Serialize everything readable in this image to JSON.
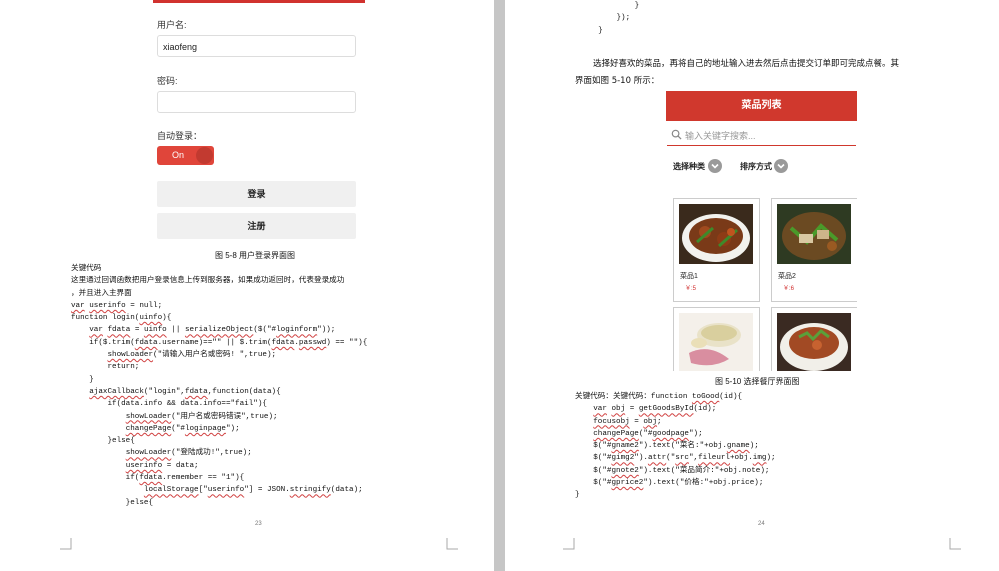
{
  "left_page": {
    "login": {
      "username_label": "用户名:",
      "username_value": "xiaofeng",
      "password_label": "密码:",
      "autologin_label": "自动登录：",
      "toggle_text": "On",
      "login_button": "登录",
      "register_button": "注册"
    },
    "caption": "图 5-8 用户登录界面图",
    "code_lines": [
      [
        {
          "t": "关键代码"
        }
      ],
      [
        {
          "t": "这里通过回调函数把用户登录信息上传到服务器，如果成功返回时，代表登录成功"
        }
      ],
      [
        {
          "t": "，并且进入主界面"
        }
      ],
      [
        {
          "t": "var",
          "s": 1
        },
        {
          "t": " "
        },
        {
          "t": "userinfo",
          "s": 1
        },
        {
          "t": " = null;"
        }
      ],
      [
        {
          "t": "function login("
        },
        {
          "t": "uinfo",
          "s": 1
        },
        {
          "t": "){"
        }
      ],
      [
        {
          "t": "    "
        },
        {
          "t": "var",
          "s": 1
        },
        {
          "t": " "
        },
        {
          "t": "fdata",
          "s": 1
        },
        {
          "t": " = "
        },
        {
          "t": "uinfo",
          "s": 1
        },
        {
          "t": " || "
        },
        {
          "t": "serializeObject",
          "s": 1
        },
        {
          "t": "($(\"#"
        },
        {
          "t": "loginform",
          "s": 1
        },
        {
          "t": "\"));"
        }
      ],
      [
        {
          "t": "    if($.trim("
        },
        {
          "t": "fdata",
          "s": 1
        },
        {
          "t": ".username)==\"\" || $.trim("
        },
        {
          "t": "fdata",
          "s": 1
        },
        {
          "t": "."
        },
        {
          "t": "passwd",
          "s": 1
        },
        {
          "t": ") == \"\"){"
        }
      ],
      [
        {
          "t": "        "
        },
        {
          "t": "showLoader",
          "s": 1
        },
        {
          "t": "(\"请输入用户名或密码! \",true);"
        }
      ],
      [
        {
          "t": "        return;"
        }
      ],
      [
        {
          "t": "    }"
        }
      ],
      [
        {
          "t": "    "
        },
        {
          "t": "ajaxCallback",
          "s": 1
        },
        {
          "t": "(\"login\","
        },
        {
          "t": "fdata",
          "s": 1
        },
        {
          "t": ",function(data){"
        }
      ],
      [
        {
          "t": "        if(data.info && data.info==\"fail\"){"
        }
      ],
      [
        {
          "t": "            "
        },
        {
          "t": "showLoader",
          "s": 1
        },
        {
          "t": "(\"用户名或密码错误\",true);"
        }
      ],
      [
        {
          "t": "            "
        },
        {
          "t": "changePage",
          "s": 1
        },
        {
          "t": "(\"#"
        },
        {
          "t": "loginpage",
          "s": 1
        },
        {
          "t": "\");"
        }
      ],
      [
        {
          "t": "        }else{"
        }
      ],
      [
        {
          "t": "            "
        },
        {
          "t": "showLoader",
          "s": 1
        },
        {
          "t": "(\"登陆成功!\",true);"
        }
      ],
      [
        {
          "t": "            "
        },
        {
          "t": "userinfo",
          "s": 1
        },
        {
          "t": " = data;"
        }
      ],
      [
        {
          "t": "            if("
        },
        {
          "t": "fdata",
          "s": 1
        },
        {
          "t": ".remember == \"1\"){"
        }
      ],
      [
        {
          "t": "                "
        },
        {
          "t": "localStorage",
          "s": 1
        },
        {
          "t": "[\""
        },
        {
          "t": "userinfo",
          "s": 1
        },
        {
          "t": "\"] = JSON."
        },
        {
          "t": "stringify",
          "s": 1
        },
        {
          "t": "(data);"
        }
      ],
      [
        {
          "t": "            }else{"
        }
      ]
    ],
    "page_number": "23"
  },
  "right_page": {
    "top_code_lines": [
      [
        {
          "t": "            }"
        }
      ],
      [
        {
          "t": "        });"
        }
      ],
      [
        {
          "t": "    }"
        }
      ]
    ],
    "paragraph_line1": "选择好喜欢的菜品，再将自己的地址输入进去然后点击提交订单即可完成点餐。其",
    "paragraph_line2": "界面如图 5-10 所示：",
    "menu": {
      "header": "菜品列表",
      "search_placeholder": "输入关键字搜索...",
      "filter_category": "选择种类",
      "filter_sort": "排序方式",
      "items": [
        {
          "name": "菜品1",
          "price": "￥:5"
        },
        {
          "name": "菜品2",
          "price": "￥:6"
        }
      ]
    },
    "caption": "图 5-10 选择餐厅界面图",
    "code_lines": [
      [
        {
          "t": "关键代码：关键代码：function "
        },
        {
          "t": "toGood",
          "s": 1
        },
        {
          "t": "(id){"
        }
      ],
      [
        {
          "t": "    "
        },
        {
          "t": "var",
          "s": 1
        },
        {
          "t": " "
        },
        {
          "t": "obj",
          "s": 1
        },
        {
          "t": " = "
        },
        {
          "t": "getGoodsById",
          "s": 1
        },
        {
          "t": "(id);"
        }
      ],
      [
        {
          "t": "    "
        },
        {
          "t": "focusobj",
          "s": 1
        },
        {
          "t": " = "
        },
        {
          "t": "obj",
          "s": 1
        },
        {
          "t": ";"
        }
      ],
      [
        {
          "t": "    "
        },
        {
          "t": "changePage",
          "s": 1
        },
        {
          "t": "(\"#"
        },
        {
          "t": "goodpage",
          "s": 1
        },
        {
          "t": "\");"
        }
      ],
      [
        {
          "t": "    $(\"#"
        },
        {
          "t": "gname2",
          "s": 1
        },
        {
          "t": "\").text(\"菜名:\"+obj."
        },
        {
          "t": "gname",
          "s": 1
        },
        {
          "t": ");"
        }
      ],
      [
        {
          "t": "    $(\"#"
        },
        {
          "t": "gimg2",
          "s": 1
        },
        {
          "t": "\")."
        },
        {
          "t": "attr",
          "s": 1
        },
        {
          "t": "(\""
        },
        {
          "t": "src",
          "s": 1
        },
        {
          "t": "\","
        },
        {
          "t": "fileurl",
          "s": 1
        },
        {
          "t": "+obj."
        },
        {
          "t": "img",
          "s": 1
        },
        {
          "t": ");"
        }
      ],
      [
        {
          "t": "    $(\"#"
        },
        {
          "t": "gnote2",
          "s": 1
        },
        {
          "t": "\").text(\"菜品简介:\"+obj.note);"
        }
      ],
      [
        {
          "t": "    $(\"#"
        },
        {
          "t": "gprice2",
          "s": 1
        },
        {
          "t": "\").text(\"价格:\"+obj.price);"
        }
      ],
      [
        {
          "t": "}"
        }
      ]
    ],
    "page_number": "24"
  }
}
